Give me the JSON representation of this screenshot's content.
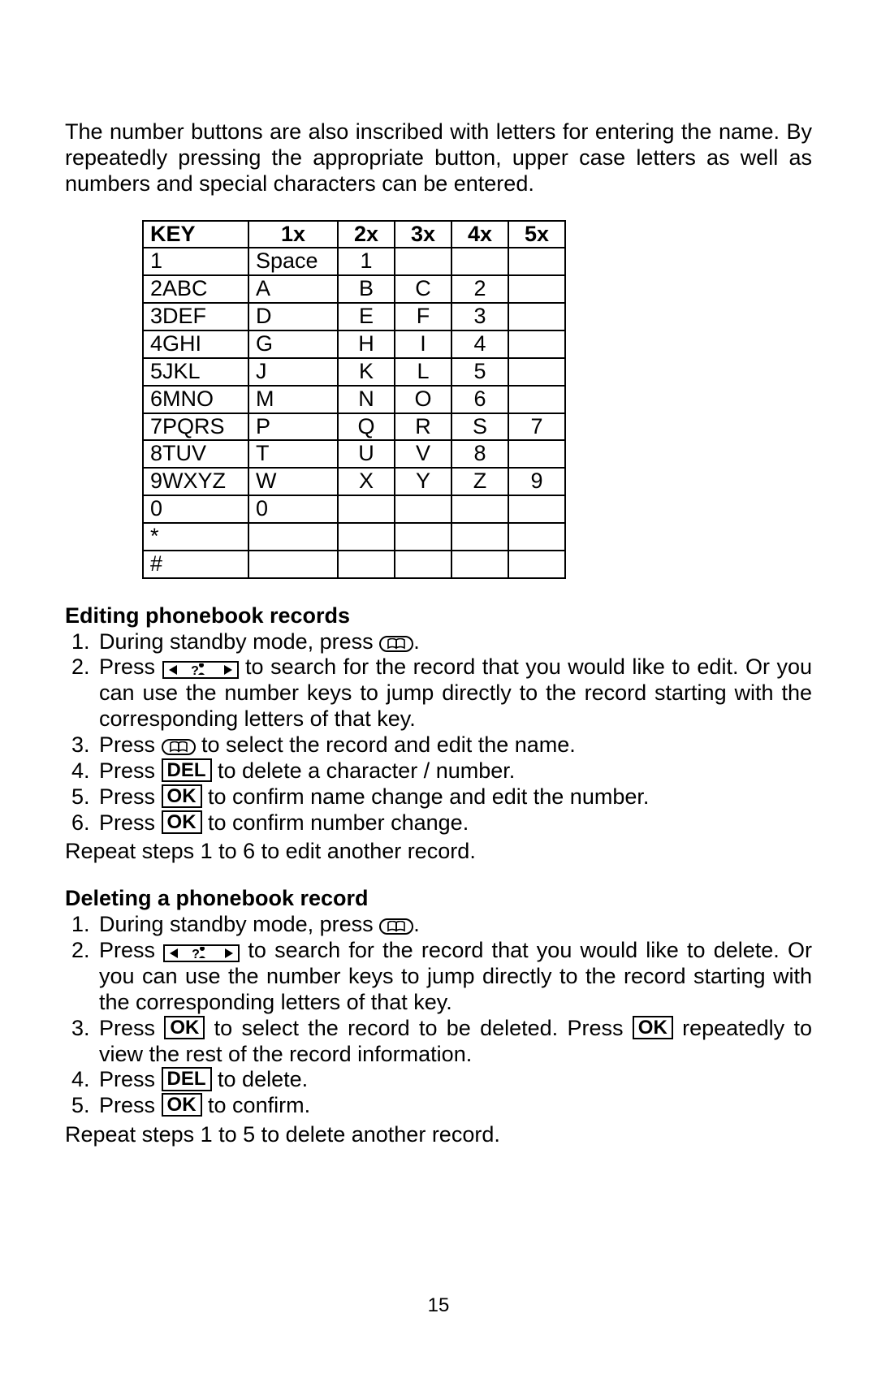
{
  "intro": "The number buttons are also inscribed with letters for entering the name. By repeatedly pressing the appropriate button, upper case letters as well as numbers and special characters can be entered.",
  "table": {
    "headers": [
      "KEY",
      "1x",
      "2x",
      "3x",
      "4x",
      "5x"
    ],
    "rows": [
      [
        "1",
        "Space",
        "1",
        "",
        "",
        ""
      ],
      [
        "2ABC",
        "A",
        "B",
        "C",
        "2",
        ""
      ],
      [
        "3DEF",
        "D",
        "E",
        "F",
        "3",
        ""
      ],
      [
        "4GHI",
        "G",
        "H",
        "I",
        "4",
        ""
      ],
      [
        "5JKL",
        "J",
        "K",
        "L",
        "5",
        ""
      ],
      [
        "6MNO",
        "M",
        "N",
        "O",
        "6",
        ""
      ],
      [
        "7PQRS",
        "P",
        "Q",
        "R",
        "S",
        "7"
      ],
      [
        "8TUV",
        "T",
        "U",
        "V",
        "8",
        ""
      ],
      [
        "9WXYZ",
        "W",
        "X",
        "Y",
        "Z",
        "9"
      ],
      [
        "0",
        "0",
        "",
        "",
        "",
        ""
      ],
      [
        "*",
        "",
        "",
        "",
        "",
        ""
      ],
      [
        "#",
        "",
        "",
        "",
        "",
        ""
      ]
    ]
  },
  "editing": {
    "title": "Editing phonebook records",
    "steps": {
      "s1a": "During standby mode, press ",
      "s1b": ".",
      "s2a": "Press ",
      "s2b": " to search for the record that you would like to edit.  Or you can use the number keys to jump directly to the record starting with the corresponding letters of that key.",
      "s3a": "Press ",
      "s3b": " to select the record and edit the name.",
      "s4a": "Press ",
      "s4b": " to delete a character / number.",
      "s5a": "Press ",
      "s5b": " to confirm name change and edit the number.",
      "s6a": "Press ",
      "s6b": " to confirm number change."
    },
    "repeat": "Repeat steps 1 to 6 to edit another record."
  },
  "deleting": {
    "title": "Deleting a phonebook record",
    "steps": {
      "s1a": "During standby mode, press ",
      "s1b": ".",
      "s2a": "Press ",
      "s2b": " to search for the record that you would like to delete. Or you can use the number keys to jump directly to the record starting with the corresponding letters of that key.",
      "s3a": "Press ",
      "s3b": " to select the record to be deleted.  Press ",
      "s3c": " repeatedly to view the rest of the record information.",
      "s4a": "Press ",
      "s4b": " to delete.",
      "s5a": "Press ",
      "s5b": " to confirm."
    },
    "repeat": "Repeat steps 1 to 5 to delete another record."
  },
  "buttons": {
    "del": "DEL",
    "ok": "OK"
  },
  "page_number": "15"
}
